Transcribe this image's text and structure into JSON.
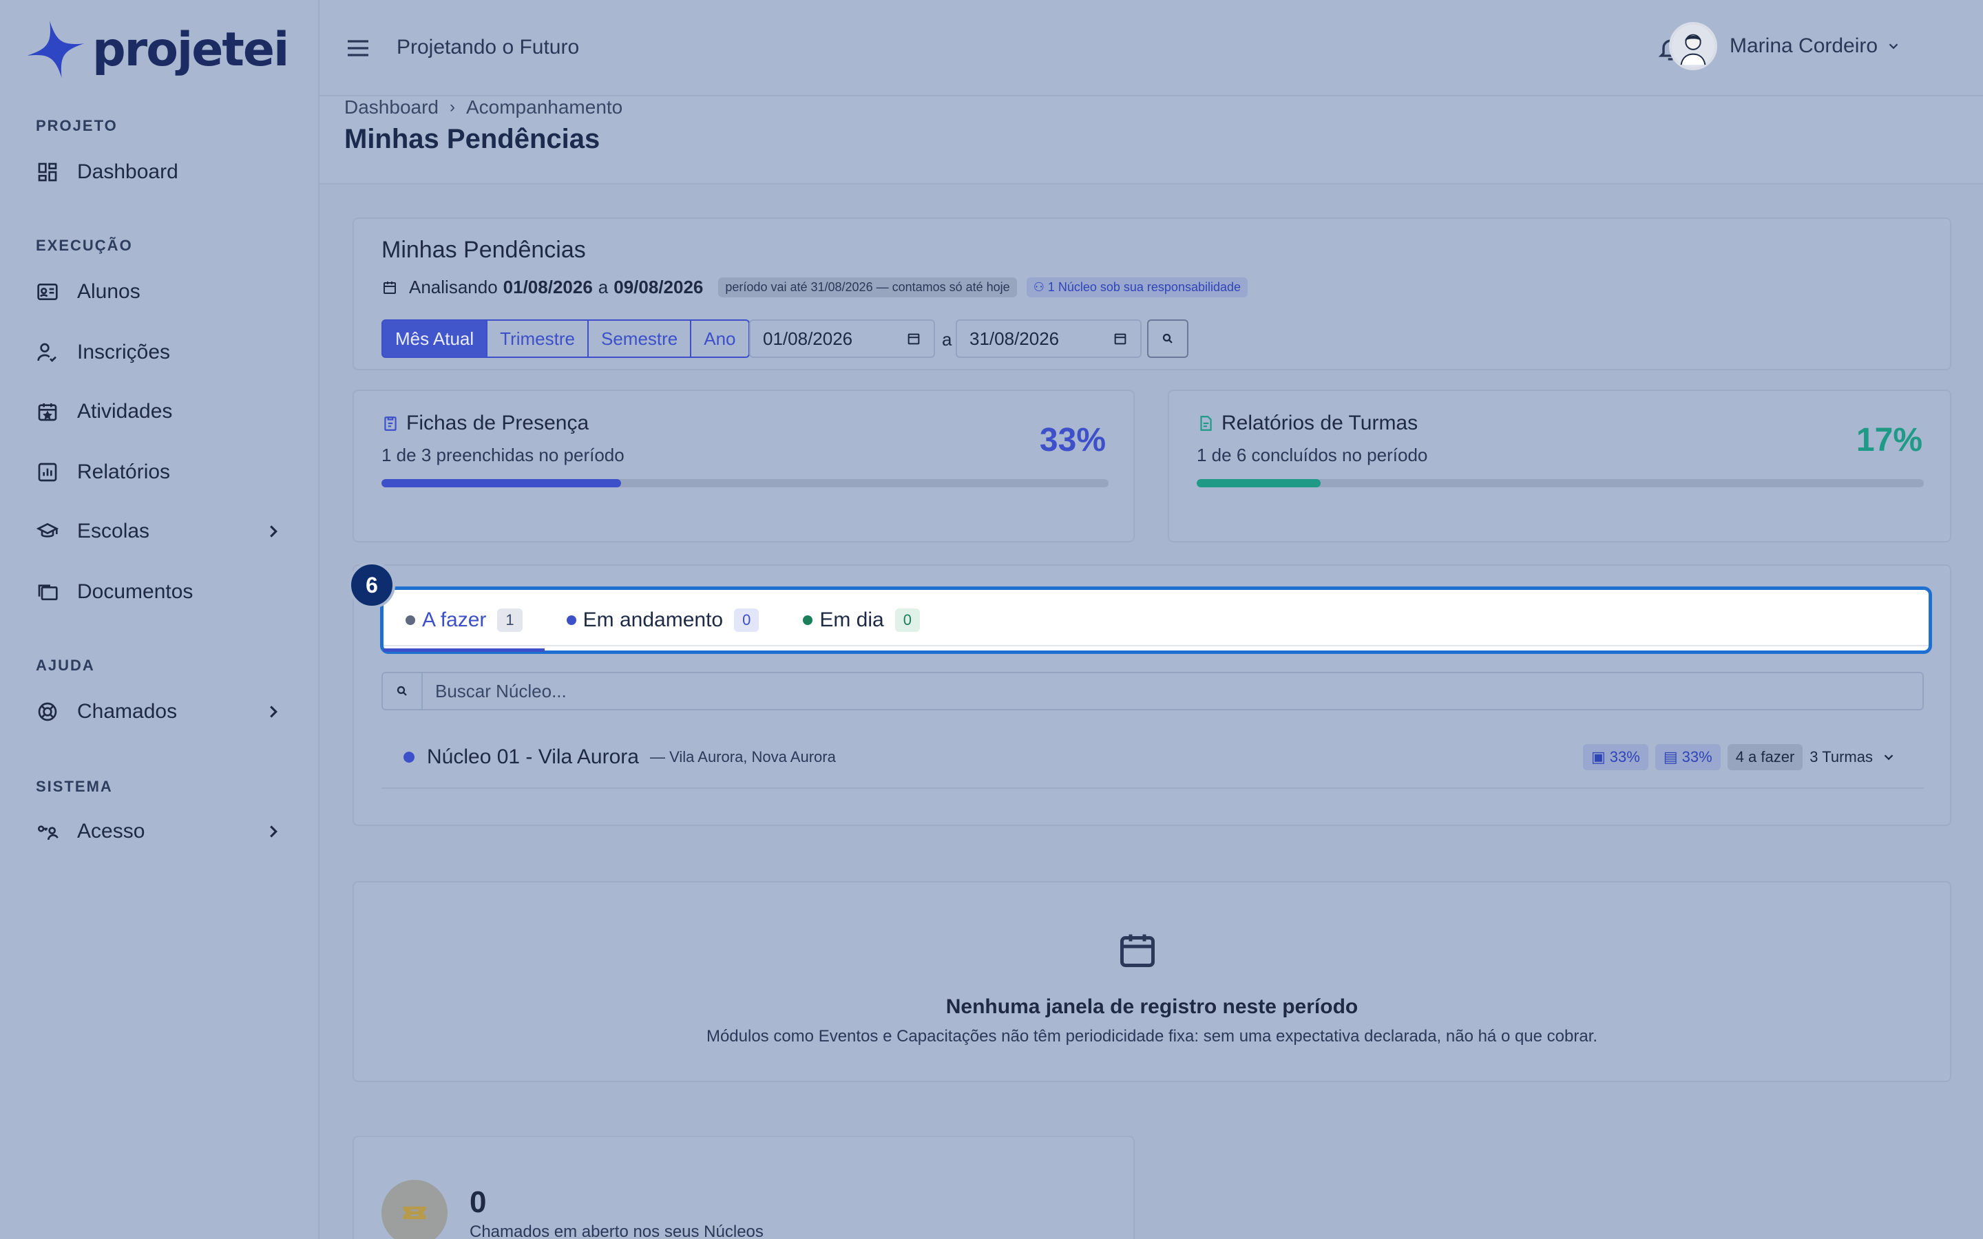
{
  "brand": {
    "logo_text": "projetei"
  },
  "header": {
    "project_name": "Projetando o Futuro",
    "user_name": "Marina Cordeiro"
  },
  "sidebar": {
    "sections": [
      {
        "label": "PROJETO"
      },
      {
        "label": "EXECUÇÃO"
      },
      {
        "label": "AJUDA"
      },
      {
        "label": "SISTEMA"
      }
    ],
    "items": [
      {
        "label": "Dashboard",
        "icon": "grid-icon"
      },
      {
        "label": "Alunos",
        "icon": "id-card-icon"
      },
      {
        "label": "Inscrições",
        "icon": "user-check-icon"
      },
      {
        "label": "Atividades",
        "icon": "calendar-star-icon"
      },
      {
        "label": "Relatórios",
        "icon": "chart-icon"
      },
      {
        "label": "Escolas",
        "icon": "school-icon"
      },
      {
        "label": "Documentos",
        "icon": "folders-icon"
      },
      {
        "label": "Chamados",
        "icon": "lifebuoy-icon"
      },
      {
        "label": "Acesso",
        "icon": "user-key-icon"
      }
    ]
  },
  "breadcrumb": {
    "items": [
      "Dashboard",
      "Acompanhamento"
    ]
  },
  "page": {
    "title": "Minhas Pendências"
  },
  "filter": {
    "title": "Minhas Pendências",
    "analisando_label": "Analisando",
    "start": "01/08/2026",
    "mid": "a",
    "end": "09/08/2026",
    "pill_periodo": "período vai até 31/08/2026 — contamos só até hoje",
    "pill_nucleo": "1 Núcleo sob sua responsabilidade",
    "segments": [
      "Mês Atual",
      "Trimestre",
      "Semestre",
      "Ano"
    ],
    "date_from": "01/08/2026",
    "date_sep": "a",
    "date_to": "31/08/2026"
  },
  "stats": {
    "fichas": {
      "title": "Fichas de Presença",
      "sub": "1 de 3 preenchidas no período",
      "pct": "33%",
      "fill": 0.33,
      "color": "#3d50c9"
    },
    "relatorios": {
      "title": "Relatórios de Turmas",
      "sub": "1 de 6 concluídos no período",
      "pct": "17%",
      "fill": 0.17,
      "color": "#1e9a86"
    }
  },
  "step_badge": "6",
  "tabs": [
    {
      "label": "A fazer",
      "count": "1",
      "dot": "#5f6a80"
    },
    {
      "label": "Em andamento",
      "count": "0",
      "dot": "#3d50c9"
    },
    {
      "label": "Em dia",
      "count": "0",
      "dot": "#1a7f5a"
    }
  ],
  "search": {
    "placeholder": "Buscar Núcleo..."
  },
  "nucleo": {
    "name": "Núcleo 01 - Vila Aurora",
    "location": "— Vila Aurora, Nova Aurora",
    "chip_fichas": "33%",
    "chip_rel": "33%",
    "chip_fazer": "4 a fazer",
    "turmas": "3 Turmas"
  },
  "empty": {
    "title": "Nenhuma janela de registro neste período",
    "sub": "Módulos como Eventos e Capacitações não têm periodicidade fixa: sem uma expectativa declarada, não há o que cobrar."
  },
  "chamados": {
    "count": "0",
    "sub": "Chamados em aberto nos seus Núcleos"
  }
}
